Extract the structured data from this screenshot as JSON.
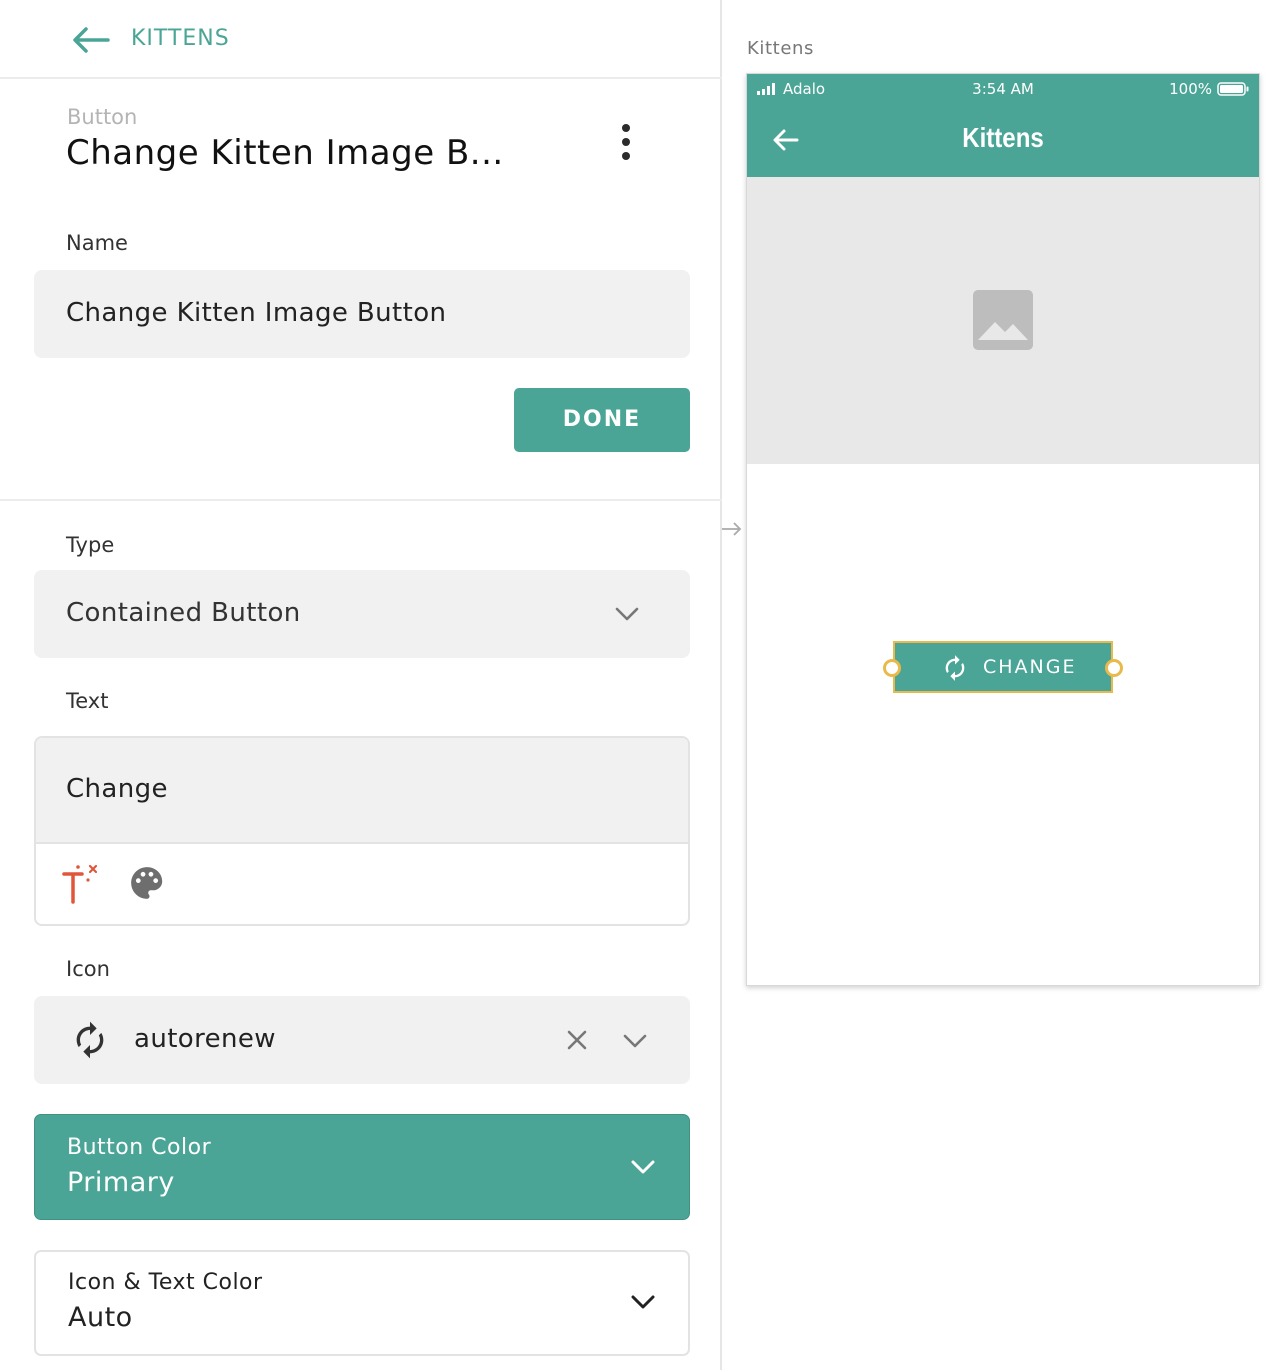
{
  "colors": {
    "accent": "#4aa596",
    "selection": "#e9b94c"
  },
  "header": {
    "back_label": "KITTENS"
  },
  "component": {
    "kind": "Button",
    "title": "Change Kitten Image B..."
  },
  "name_field": {
    "label": "Name",
    "value": "Change Kitten Image Button",
    "done_label": "DONE"
  },
  "type_field": {
    "label": "Type",
    "value": "Contained Button"
  },
  "text_field": {
    "label": "Text",
    "value": "Change"
  },
  "icon_field": {
    "label": "Icon",
    "value": "autorenew",
    "icon": "autorenew-icon"
  },
  "button_color": {
    "label": "Button Color",
    "value": "Primary"
  },
  "icon_text_color": {
    "label": "Icon & Text Color",
    "value": "Auto"
  },
  "canvas": {
    "screen_name": "Kittens",
    "status": {
      "carrier": "Adalo",
      "time": "3:54 AM",
      "battery": "100%"
    },
    "app_title": "Kittens",
    "button_text": "CHANGE"
  }
}
